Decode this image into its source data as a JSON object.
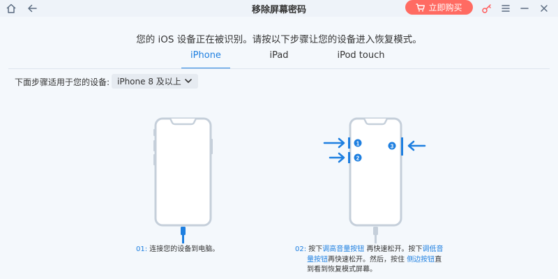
{
  "window": {
    "title": "移除屏幕密码",
    "buy_label": "立即购买"
  },
  "icons": {
    "home": "home-icon",
    "back": "back-arrow-icon",
    "cart": "cart-icon",
    "key": "key-icon",
    "menu": "menu-icon",
    "minimize": "minimize-icon",
    "close": "close-icon"
  },
  "main": {
    "heading": "您的 iOS 设备正在被识别。请按以下步骤让您的设备进入恢复模式。",
    "tabs": [
      {
        "label": "iPhone",
        "active": true
      },
      {
        "label": "iPad",
        "active": false
      },
      {
        "label": "iPod touch",
        "active": false
      }
    ],
    "device_label": "下面步骤适用于您的设备:",
    "device_select": "iPhone 8 及以上",
    "step1": {
      "num": "01:",
      "text": "连接您的设备到电脑。"
    },
    "step2": {
      "num": "02:",
      "p1": "按下",
      "vol_up": "调高音量按钮",
      "p2": " 再快速松开。按下",
      "vol_down_a": "调低音",
      "vol_down_b": "量按钮",
      "p3": "再快速松开。然后，按住 ",
      "side": "侧边按钮",
      "p4": "直",
      "p5": "到看到恢复模式屏幕。"
    },
    "badges": [
      "1",
      "2",
      "3"
    ]
  },
  "colors": {
    "accent": "#1e7fe0",
    "buy": "#ff6b62",
    "phone_outline": "#c5cfda"
  }
}
